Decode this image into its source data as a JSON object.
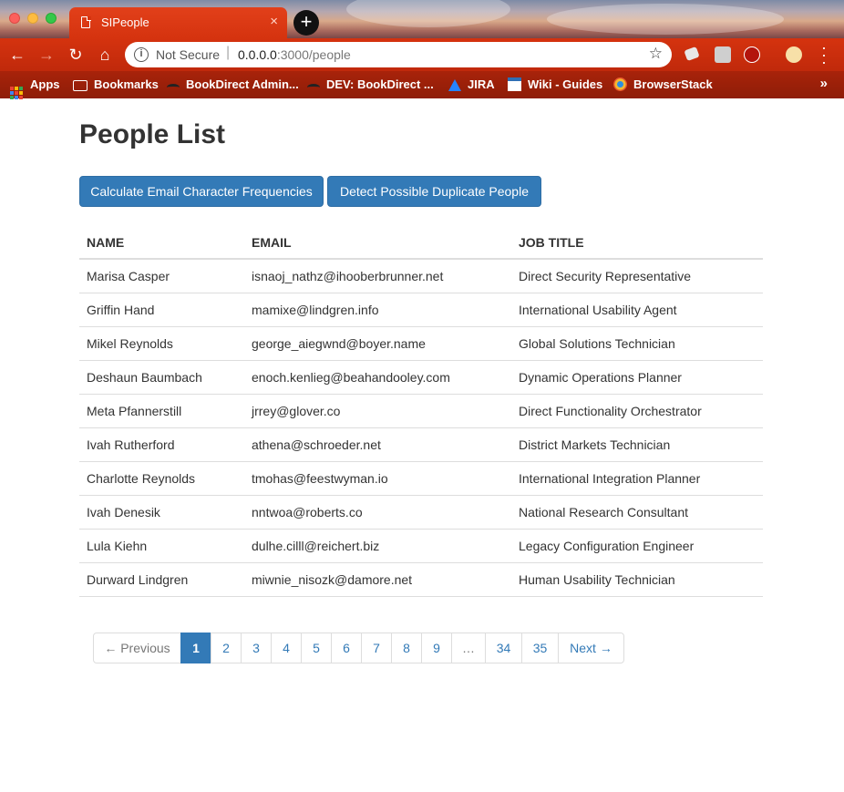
{
  "browser": {
    "tab_title": "SIPeople",
    "tab_close": "×",
    "new_tab": "+",
    "security_label": "Not Secure",
    "url_host": "0.0.0.0",
    "url_path": ":3000/people",
    "bookmarks": [
      {
        "label": "Apps",
        "icon": "apps-grid-icon"
      },
      {
        "label": "Bookmarks",
        "icon": "folder-icon"
      },
      {
        "label": "BookDirect Admin...",
        "icon": "bookdirect-icon"
      },
      {
        "label": "DEV: BookDirect ...",
        "icon": "bookdirect-icon"
      },
      {
        "label": "JIRA",
        "icon": "jira-icon"
      },
      {
        "label": "Wiki - Guides",
        "icon": "wiki-icon"
      },
      {
        "label": "BrowserStack",
        "icon": "browserstack-icon"
      }
    ],
    "bookmarks_more": "»",
    "colors": {
      "chrome_accent": "#d5330f",
      "bookmarks_bar": "#a8230a"
    }
  },
  "page": {
    "title": "People List",
    "buttons": {
      "frequencies": "Calculate Email Character Frequencies",
      "duplicates": "Detect Possible Duplicate People"
    },
    "table": {
      "headers": [
        "NAME",
        "EMAIL",
        "JOB TITLE"
      ],
      "rows": [
        [
          "Marisa Casper",
          "isnaoj_nathz@ihooberbrunner.net",
          "Direct Security Representative"
        ],
        [
          "Griffin Hand",
          "mamixe@lindgren.info",
          "International Usability Agent"
        ],
        [
          "Mikel Reynolds",
          "george_aiegwnd@boyer.name",
          "Global Solutions Technician"
        ],
        [
          "Deshaun Baumbach",
          "enoch.kenlieg@beahandooley.com",
          "Dynamic Operations Planner"
        ],
        [
          "Meta Pfannerstill",
          "jrrey@glover.co",
          "Direct Functionality Orchestrator"
        ],
        [
          "Ivah Rutherford",
          "athena@schroeder.net",
          "District Markets Technician"
        ],
        [
          "Charlotte Reynolds",
          "tmohas@feestwyman.io",
          "International Integration Planner"
        ],
        [
          "Ivah Denesik",
          "nntwoa@roberts.co",
          "National Research Consultant"
        ],
        [
          "Lula Kiehn",
          "dulhe.cilll@reichert.biz",
          "Legacy Configuration Engineer"
        ],
        [
          "Durward Lindgren",
          "miwnie_nisozk@damore.net",
          "Human Usability Technician"
        ]
      ]
    },
    "pagination": {
      "previous": "← Previous",
      "pages": [
        "1",
        "2",
        "3",
        "4",
        "5",
        "6",
        "7",
        "8",
        "9",
        "…",
        "34",
        "35"
      ],
      "current": "1",
      "next": "Next →"
    },
    "colors": {
      "primary": "#337ab7",
      "text": "#333333"
    }
  }
}
